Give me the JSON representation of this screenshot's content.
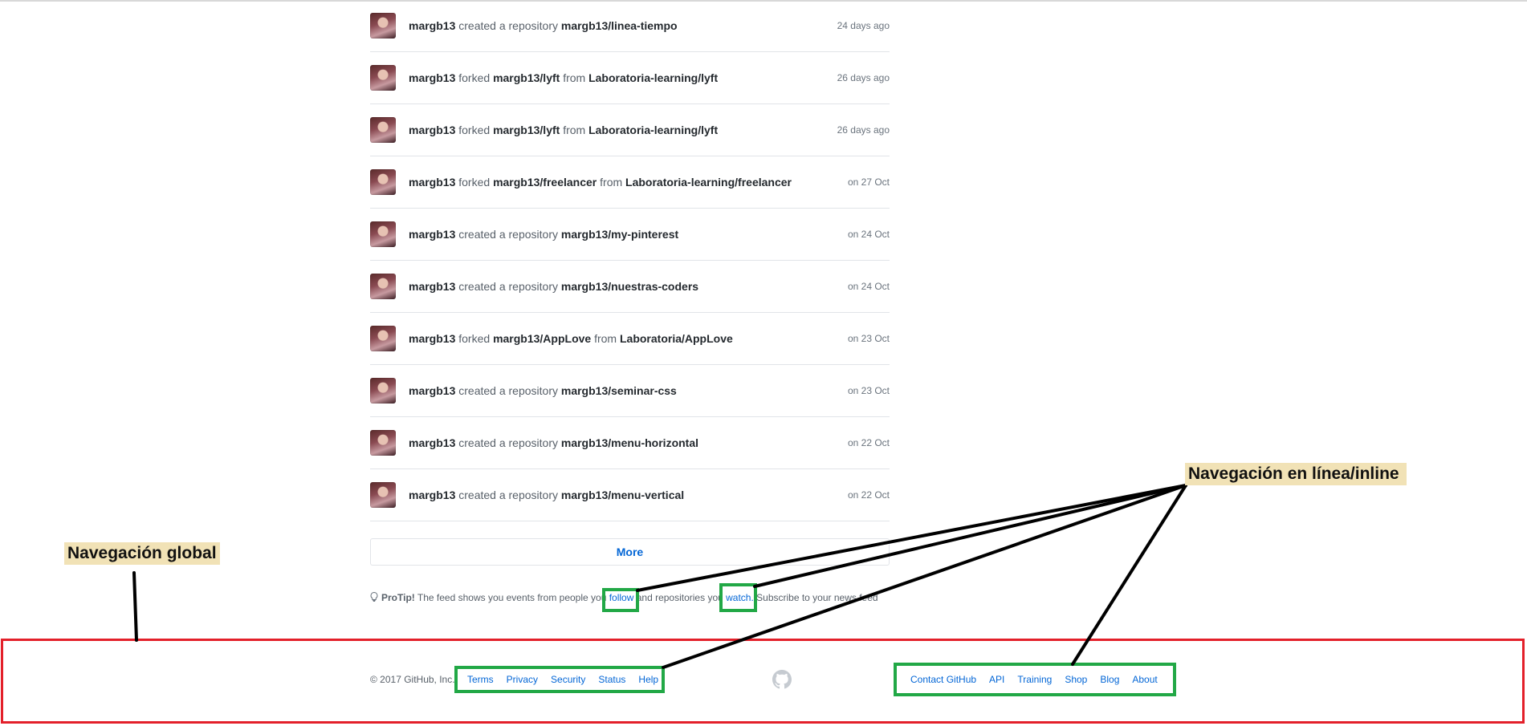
{
  "feed": {
    "items": [
      {
        "user": "margb13",
        "parts": [
          {
            "t": " created a repository ",
            "b": false
          },
          {
            "t": "margb13/linea-tiempo",
            "b": true
          }
        ],
        "time": "24 days ago"
      },
      {
        "user": "margb13",
        "parts": [
          {
            "t": " forked ",
            "b": false
          },
          {
            "t": "margb13/lyft",
            "b": true
          },
          {
            "t": " from ",
            "b": false
          },
          {
            "t": "Laboratoria-learning/lyft",
            "b": true
          }
        ],
        "time": "26 days ago"
      },
      {
        "user": "margb13",
        "parts": [
          {
            "t": " forked ",
            "b": false
          },
          {
            "t": "margb13/lyft",
            "b": true
          },
          {
            "t": " from ",
            "b": false
          },
          {
            "t": "Laboratoria-learning/lyft",
            "b": true
          }
        ],
        "time": "26 days ago"
      },
      {
        "user": "margb13",
        "parts": [
          {
            "t": " forked ",
            "b": false
          },
          {
            "t": "margb13/freelancer",
            "b": true
          },
          {
            "t": " from ",
            "b": false
          },
          {
            "t": "Laboratoria-learning/freelancer",
            "b": true
          }
        ],
        "time": "on 27 Oct"
      },
      {
        "user": "margb13",
        "parts": [
          {
            "t": " created a repository ",
            "b": false
          },
          {
            "t": "margb13/my-pinterest",
            "b": true
          }
        ],
        "time": "on 24 Oct"
      },
      {
        "user": "margb13",
        "parts": [
          {
            "t": " created a repository ",
            "b": false
          },
          {
            "t": "margb13/nuestras-coders",
            "b": true
          }
        ],
        "time": "on 24 Oct"
      },
      {
        "user": "margb13",
        "parts": [
          {
            "t": " forked ",
            "b": false
          },
          {
            "t": "margb13/AppLove",
            "b": true
          },
          {
            "t": " from ",
            "b": false
          },
          {
            "t": "Laboratoria/AppLove",
            "b": true
          }
        ],
        "time": "on 23 Oct"
      },
      {
        "user": "margb13",
        "parts": [
          {
            "t": " created a repository ",
            "b": false
          },
          {
            "t": "margb13/seminar-css",
            "b": true
          }
        ],
        "time": "on 23 Oct"
      },
      {
        "user": "margb13",
        "parts": [
          {
            "t": " created a repository ",
            "b": false
          },
          {
            "t": "margb13/menu-horizontal",
            "b": true
          }
        ],
        "time": "on 22 Oct"
      },
      {
        "user": "margb13",
        "parts": [
          {
            "t": " created a repository ",
            "b": false
          },
          {
            "t": "margb13/menu-vertical",
            "b": true
          }
        ],
        "time": "on 22 Oct"
      }
    ],
    "more_label": "More"
  },
  "protip": {
    "label": "ProTip!",
    "text1": " The feed shows you events from people you ",
    "link1": "follow",
    "text2": " and repositories you ",
    "link2": "watch.",
    "text3": " Subscribe to your news feed"
  },
  "footer": {
    "copyright": "© 2017 GitHub, Inc.",
    "left_links": [
      "Terms",
      "Privacy",
      "Security",
      "Status",
      "Help"
    ],
    "right_links": [
      "Contact GitHub",
      "API",
      "Training",
      "Shop",
      "Blog",
      "About"
    ]
  },
  "annotations": {
    "global": "Navegación global",
    "inline": "Navegación en línea/inline"
  },
  "colors": {
    "link": "#0366d6",
    "highlight_red": "#e3202a",
    "highlight_green": "#22a846",
    "label_bg": "#f1e2b6"
  }
}
